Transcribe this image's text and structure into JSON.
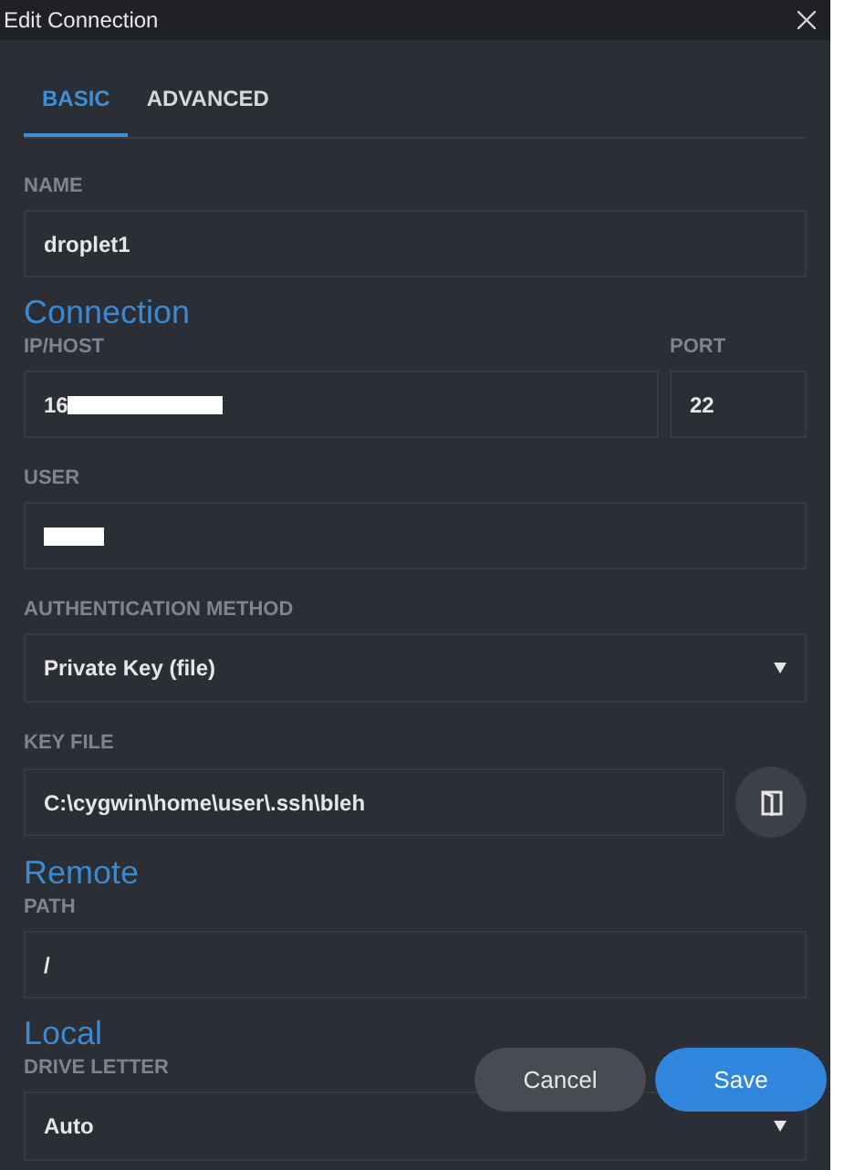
{
  "window": {
    "title": "Edit Connection"
  },
  "tabs": [
    {
      "label": "BASIC",
      "selected": true
    },
    {
      "label": "ADVANCED",
      "selected": false
    }
  ],
  "sections": [
    {
      "kind": "fields",
      "rows": [
        [
          {
            "kind": "text",
            "label": "NAME",
            "value": "droplet1",
            "redacted": false
          }
        ]
      ]
    },
    {
      "kind": "heading",
      "title": "Connection"
    },
    {
      "kind": "fields",
      "rows": [
        [
          {
            "kind": "text",
            "label": "IP/HOST",
            "value": "16",
            "redacted": true
          },
          {
            "kind": "text",
            "label": "PORT",
            "value": "22",
            "redacted": false
          }
        ],
        [
          {
            "kind": "text",
            "label": "USER",
            "redacted": true
          }
        ],
        [
          {
            "kind": "select",
            "label": "AUTHENTICATION METHOD",
            "value": "Private Key (file)"
          }
        ],
        [
          {
            "kind": "file",
            "label": "KEY FILE",
            "value": "C:\\cygwin\\home\\user\\.ssh\\bleh"
          }
        ]
      ]
    },
    {
      "kind": "heading",
      "title": "Remote"
    },
    {
      "kind": "fields",
      "rows": [
        [
          {
            "kind": "text",
            "label": "PATH",
            "value": "/",
            "redacted": false
          }
        ]
      ]
    },
    {
      "kind": "heading",
      "title": "Local"
    },
    {
      "kind": "fields",
      "rows": [
        [
          {
            "kind": "select",
            "label": "DRIVE LETTER",
            "value": "Auto"
          }
        ]
      ]
    }
  ],
  "buttons": [
    {
      "label": "Cancel",
      "kind": "secondary"
    },
    {
      "label": "Save",
      "kind": "primary"
    }
  ]
}
